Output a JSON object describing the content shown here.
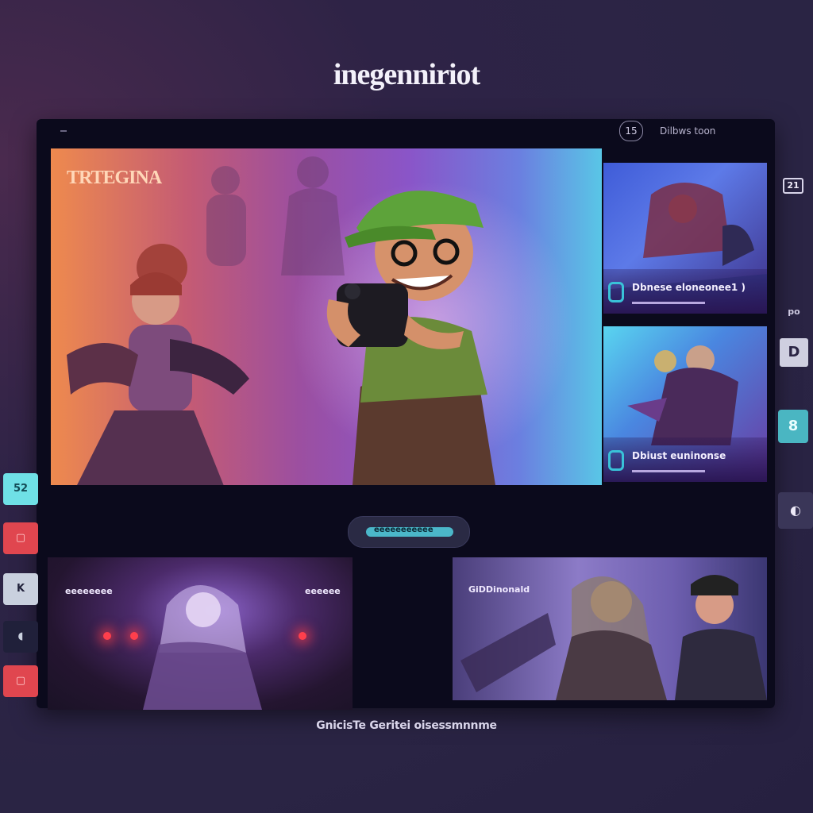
{
  "app": {
    "title": "inegenniriot"
  },
  "topbar": {
    "badge": "15",
    "menu_label": "Dilbws toon"
  },
  "hero": {
    "title": "TRTEGINA"
  },
  "side_cards": [
    {
      "title": "Dbnese eloneonee1 )"
    },
    {
      "title": "Dbiust euninonse"
    }
  ],
  "pager": {
    "label": "eeeeeeeeeee"
  },
  "thumbnails": [
    {
      "left_label": "eeeeeeee",
      "right_label": "eeeeee"
    },
    {
      "label": "GiDDinonald"
    }
  ],
  "left_rail": {
    "items": [
      {
        "label": "52",
        "color": "#6fe0e6"
      },
      {
        "label": "▢",
        "color": "#e0464f"
      },
      {
        "label": "K",
        "color": "#c9d0de"
      },
      {
        "label": "◖",
        "color": "#20203a"
      },
      {
        "label": "▢",
        "color": "#e0464f"
      }
    ]
  },
  "right_rail": {
    "items": [
      {
        "label": "21"
      },
      {
        "label": "po"
      },
      {
        "label": "D"
      },
      {
        "label": "8"
      },
      {
        "label": "◐"
      }
    ]
  },
  "footer": {
    "caption": "GnicisTe Geritei oisessmnnme"
  }
}
